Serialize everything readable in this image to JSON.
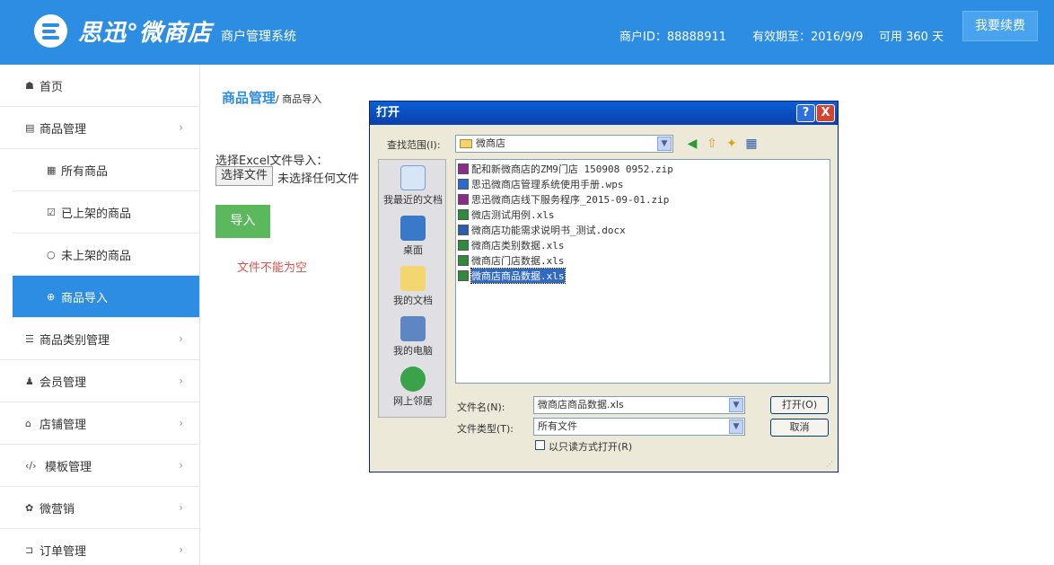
{
  "header": {
    "brand_name": "思迅°微商店",
    "brand_subtitle": "商户管理系统",
    "merchant_id": "商户ID：88888911",
    "valid_until": "有效期至：2016/9/9",
    "available_days": "可用 360 天",
    "renew_button": "我要续费",
    "colors": {
      "primary": "#2d8de2",
      "success": "#5cb85c",
      "danger": "#d9534f"
    }
  },
  "sidebar": {
    "items": [
      {
        "icon": "home-icon",
        "glyph": "☗",
        "label": "首页"
      },
      {
        "icon": "list-icon",
        "glyph": "▤",
        "label": "商品管理",
        "chevron": "›"
      },
      {
        "icon": "grid-icon",
        "glyph": "▦",
        "label": "所有商品"
      },
      {
        "icon": "check-square-icon",
        "glyph": "☑",
        "label": "已上架的商品"
      },
      {
        "icon": "circle-icon",
        "glyph": "○",
        "label": "未上架的商品"
      },
      {
        "icon": "plus-circle-icon",
        "glyph": "⊕",
        "label": "商品导入"
      },
      {
        "icon": "list-bullets-icon",
        "glyph": "☰",
        "label": "商品类别管理",
        "chevron": "›"
      },
      {
        "icon": "user-icon",
        "glyph": "♟",
        "label": "会员管理",
        "chevron": "›"
      },
      {
        "icon": "bank-icon",
        "glyph": "⌂",
        "label": "店铺管理",
        "chevron": "›"
      },
      {
        "icon": "code-icon",
        "glyph": "‹/›",
        "label": "模板管理",
        "chevron": "›"
      },
      {
        "icon": "gift-icon",
        "glyph": "✿",
        "label": "微营销",
        "chevron": "›"
      },
      {
        "icon": "cart-icon",
        "glyph": "⊐",
        "label": "订单管理",
        "chevron": "›"
      }
    ]
  },
  "main": {
    "breadcrumb_title": "商品管理",
    "breadcrumb_sub": "/ 商品导入",
    "import_label": "选择Excel文件导入：",
    "choose_file_button": "选择文件",
    "no_file_text": "未选择任何文件",
    "import_button": "导入",
    "error_text": "文件不能为空"
  },
  "dialog": {
    "title": "打开",
    "help_button": "?",
    "close_button": "X",
    "look_in_label": "查找范围(I):",
    "look_in_value": "微商店",
    "places": [
      {
        "icon": "recent-docs-icon",
        "label": "我最近的文档"
      },
      {
        "icon": "desktop-icon",
        "label": "桌面"
      },
      {
        "icon": "my-documents-icon",
        "label": "我的文档"
      },
      {
        "icon": "my-computer-icon",
        "label": "我的电脑"
      },
      {
        "icon": "network-places-icon",
        "label": "网上邻居"
      }
    ],
    "files": [
      {
        "type": "zip",
        "name": "配和新微商店的ZM9门店 150908 0952.zip"
      },
      {
        "type": "wps",
        "name": "思迅微商店管理系统使用手册.wps"
      },
      {
        "type": "zip",
        "name": "思迅微商店线下服务程序_2015-09-01.zip"
      },
      {
        "type": "xls",
        "name": "微店测试用例.xls"
      },
      {
        "type": "docx",
        "name": "微商店功能需求说明书_测试.docx"
      },
      {
        "type": "xls",
        "name": "微商店类别数据.xls"
      },
      {
        "type": "xls",
        "name": "微商店门店数据.xls"
      },
      {
        "type": "xls",
        "name": "微商店商品数据.xls",
        "selected": true
      }
    ],
    "file_name_label": "文件名(N):",
    "file_name_value": "微商店商品数据.xls",
    "file_type_label": "文件类型(T):",
    "file_type_value": "所有文件",
    "open_button": "打开(O)",
    "cancel_button": "取消",
    "readonly_label": "以只读方式打开(R)"
  }
}
